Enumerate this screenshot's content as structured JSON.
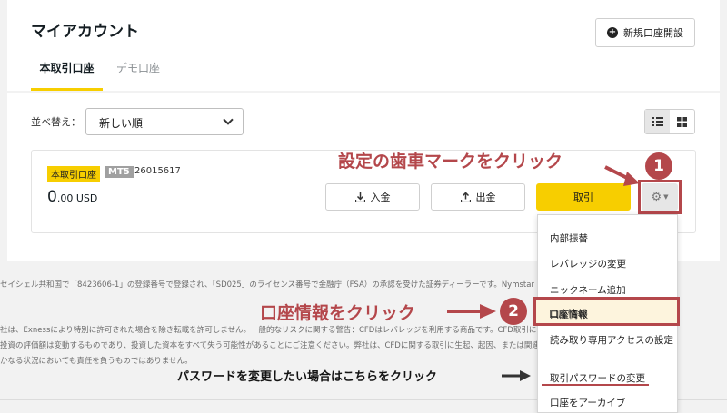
{
  "header": {
    "title": "マイアカウント",
    "new_account": "新規口座開設"
  },
  "tabs": {
    "real": "本取引口座",
    "demo": "デモ口座"
  },
  "toolbar": {
    "sort_label": "並べ替え：",
    "sort_value": "新しい順"
  },
  "account": {
    "type_badge": "本取引口座",
    "platform_badge": "MT5",
    "number": "26015617",
    "balance_int": "0",
    "balance_dec": ".00 USD",
    "deposit": "入金",
    "withdraw": "出金",
    "trade": "取引"
  },
  "dropdown": {
    "items": [
      "内部振替",
      "レバレッジの変更",
      "ニックネーム追加",
      "口座情報",
      "読み取り専用アクセスの設定",
      "取引パスワードの変更",
      "口座をアーカイブ"
    ]
  },
  "disclaimers": [
    "セイシェル共和国で「8423606-1」の登録番号で登録され、「SD025」のライセンス番号で金融庁（FSA）の承認を受けた証券ディーラーです。Nymstar Limited",
    "社は、Exnessにより特別に許可された場合を除き転載を許可しません。一般的なリスクに関する警告：CFDはレバレッジを利用する商品です。CFD取引には",
    "投資の評価額は変動するものであり、投資した資本をすべて失う可能性があることにご注意ください。弊社は、CFDに関する取引に生起、起因、または関連する",
    "かなる状況においても責任を負うものではありません。"
  ],
  "annotations": {
    "gear_hint": "設定の歯車マークをクリック",
    "info_hint": "口座情報をクリック",
    "password_hint": "パスワードを変更したい場合はこちらをクリック",
    "step1": "1",
    "step2": "2"
  },
  "colors": {
    "accent": "#f7ce00",
    "annotation": "#b4474b"
  }
}
